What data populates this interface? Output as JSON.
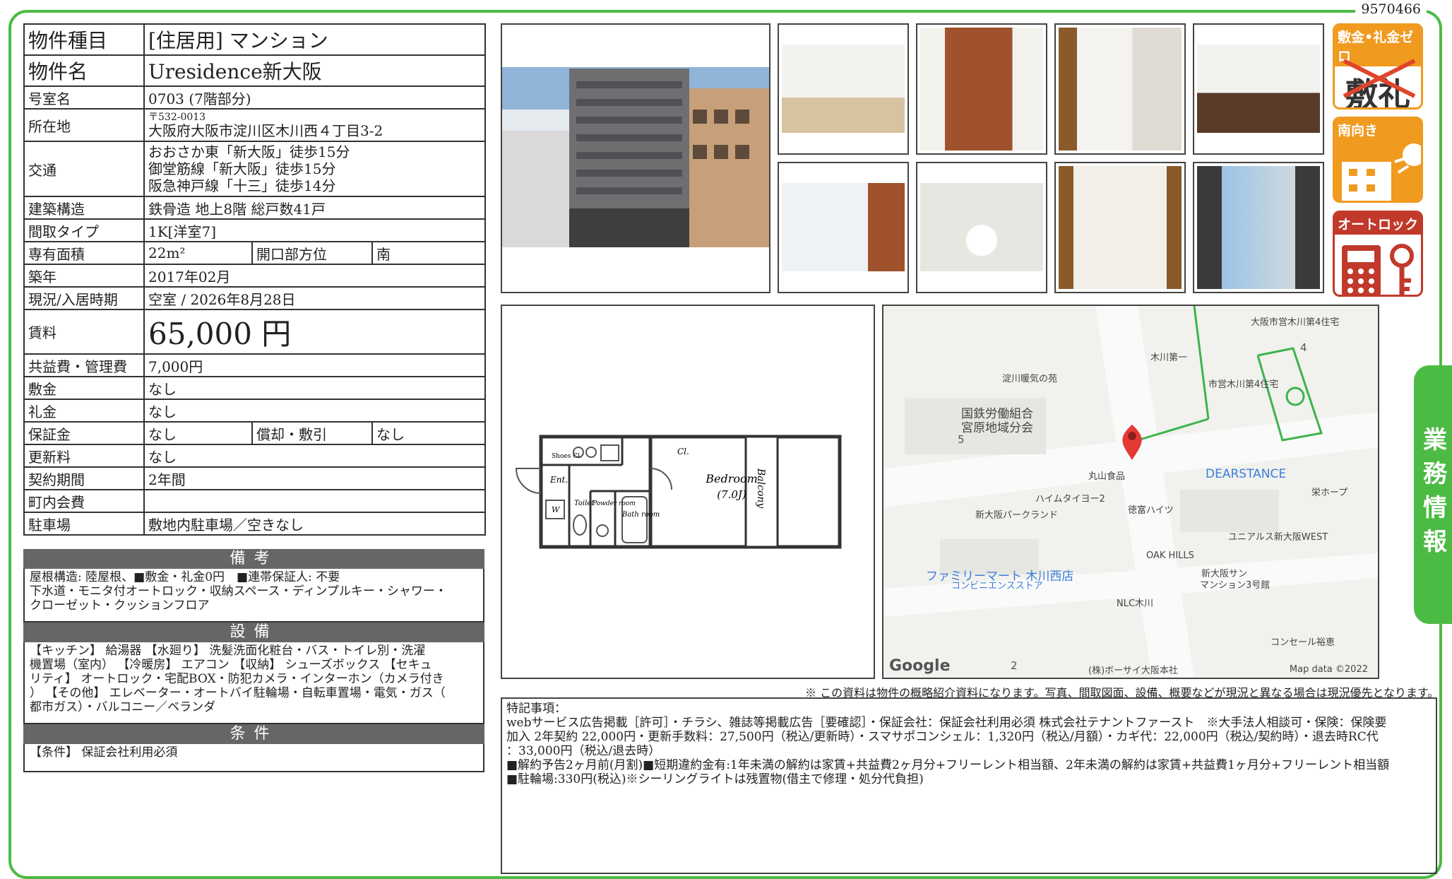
{
  "doc_id": "9570466",
  "side_tab": "業務情報",
  "table": {
    "type_label": "物件種目",
    "type_value": "[住居用] マンション",
    "name_label": "物件名",
    "name_value": "Uresidence新大阪",
    "room_label": "号室名",
    "room_value": "0703 (7階部分)",
    "addr_label": "所在地",
    "addr_zip": "〒532-0013",
    "addr_value": "大阪府大阪市淀川区木川西４丁目3-2",
    "traffic_label": "交通",
    "traffic_1": "おおさか東「新大阪」徒歩15分",
    "traffic_2": "御堂筋線「新大阪」徒歩15分",
    "traffic_3": "阪急神戸線「十三」徒歩14分",
    "structure_label": "建築構造",
    "structure_value": "鉄骨造 地上8階 総戸数41戸",
    "layout_label": "間取タイプ",
    "layout_value": "1K[洋室7]",
    "area_label": "専有面積",
    "area_value": "22m²",
    "direction_label": "開口部方位",
    "direction_value": "南",
    "built_label": "築年",
    "built_value": "2017年02月",
    "status_label": "現況/入居時期",
    "status_value": "空室 / 2026年8月28日",
    "rent_label": "賃料",
    "rent_value": "65,000 円",
    "common_label": "共益費・管理費",
    "common_value": "7,000円",
    "deposit_label": "敷金",
    "deposit_value": "なし",
    "key_label": "礼金",
    "key_value": "なし",
    "guarantee_label": "保証金",
    "guarantee_value": "なし",
    "amort_label": "償却・敷引",
    "amort_value": "なし",
    "renewal_label": "更新料",
    "renewal_value": "なし",
    "contract_label": "契約期間",
    "contract_value": "2年間",
    "assoc_label": "町内会費",
    "assoc_value": "",
    "parking_label": "駐車場",
    "parking_value": "敷地内駐車場／空きなし"
  },
  "bikou": {
    "title": "備考",
    "text": "屋根構造: 陸屋根、■敷金・礼金0円　■連帯保証人: 不要\n下水道・モニタ付オートロック・収納スペース・ディンプルキー・シャワー・\nクローゼット・クッションフロア"
  },
  "setsubi": {
    "title": "設備",
    "text": "【キッチン】 給湯器 【水廻り】 洗髪洗面化粧台・バス・トイレ別・洗濯\n機置場（室内） 【冷暖房】 エアコン 【収納】 シューズボックス 【セキュ\nリティ】 オートロック・宅配BOX・防犯カメラ・インターホン（カメラ付き\n） 【その他】 エレベーター・オートバイ駐輪場・自転車置場・電気・ガス（\n都市ガス）・バルコニー／ベランダ"
  },
  "jouken": {
    "title": "条件",
    "text": "【条件】 保証会社利用必須"
  },
  "badges": {
    "zero": "敷金•礼金ゼロ",
    "zero_chars": "敷礼",
    "south": "南向き",
    "autolock": "オートロック"
  },
  "floorplan": {
    "bedroom": "Bedroom",
    "bedroom_size": "(7.0J)",
    "balcony": "Balcony",
    "ent": "Ent.",
    "cl": "Cl.",
    "shoes": "Shoes Cl.",
    "toilet": "Toilet",
    "powder": "Powder room",
    "bath": "Bath room",
    "w": "W"
  },
  "map": {
    "labels": [
      "大阪市営木川第4住宅",
      "木川第一",
      "淀川暖気の苑",
      "市営木川第4住宅",
      "国鉄労働組合",
      "宮原地域分会",
      "丸山食品",
      "DEARSTANCE",
      "栄ホープ",
      "ハイムタイヨー2",
      "徳富ハイツ",
      "新大阪パークランド",
      "ユニアルス新大阪WEST",
      "OAK HILLS",
      "新大阪サン",
      "マンション3号館",
      "ファミリーマート 木川西店",
      "コンビニエンスストア",
      "NLC木川",
      "コンセール裕恵",
      "(株)ボーサイ大阪本社"
    ],
    "numbers": [
      "4",
      "5",
      "2"
    ],
    "google": "Google",
    "credit": "Map data ©2022"
  },
  "disclaimer": "※ この資料は物件の概略紹介資料になります。写真、間取図面、設備、概要などが現況と異なる場合は現況優先となります。",
  "remarks": {
    "title": "特記事項：",
    "lines": [
      "webサービス広告掲載［許可］・チラシ、雑誌等掲載広告［要確認］・保証会社：保証会社利用必須 株式会社テナントファースト　※大手法人相談可・保険：保険要",
      "加入 2年契約 22,000円・更新手数料：27,500円（税込/更新時）・スマサポコンシェル：1,320円（税込/月額）・カギ代：22,000円（税込/契約時）・退去時RC代",
      "：33,000円（税込/退去時）",
      "■解約予告2ヶ月前(月割)■短期違約金有:1年未満の解約は家賃+共益費2ヶ月分+フリーレント相当額、2年未満の解約は家賃+共益費1ヶ月分+フリーレント相当額",
      "■駐輪場:330円(税込)※シーリングライトは残置物(借主で修理・処分代負担)"
    ]
  },
  "colors": {
    "frame": "#4cbb44",
    "badge": "#f09a20",
    "badge_red": "#c0392b",
    "band": "#666666",
    "map_pin": "#e53935"
  }
}
